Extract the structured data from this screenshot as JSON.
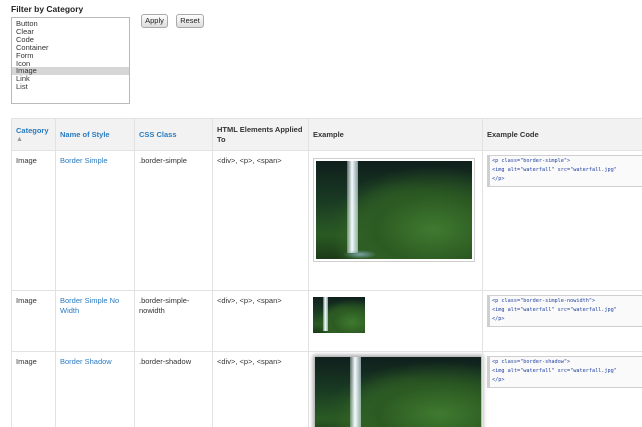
{
  "filter": {
    "title": "Filter by Category",
    "options": [
      "Button",
      "Clear",
      "Code",
      "Container",
      "Form",
      "Icon",
      "Image",
      "Link",
      "List"
    ],
    "selected": "Image",
    "apply_label": "Apply",
    "reset_label": "Reset"
  },
  "table": {
    "headers": {
      "category": "Category",
      "name": "Name of Style",
      "css_class": "CSS Class",
      "html_elements": "HTML Elements Applied To",
      "example": "Example",
      "example_code": "Example Code"
    },
    "sort_indicator": "▲",
    "rows": [
      {
        "category": "Image",
        "name": "Border Simple",
        "css_class": ".border-simple",
        "html_elements": "<div>, <p>, <span>",
        "code": [
          "<p class=\"border-simple\">",
          "<img alt=\"waterfall\" src=\"waterfall.jpg\"",
          "</p>"
        ]
      },
      {
        "category": "Image",
        "name": "Border Simple No Width",
        "css_class": ".border-simple-nowidth",
        "html_elements": "<div>, <p>, <span>",
        "code": [
          "<p class=\"border-simple-nowidth\">",
          "<img alt=\"waterfall\" src=\"waterfall.jpg\"",
          "</p>"
        ]
      },
      {
        "category": "Image",
        "name": "Border Shadow",
        "css_class": ".border-shadow",
        "html_elements": "<div>, <p>, <span>",
        "code": [
          "<p class=\"border-shadow\">",
          "<img alt=\"waterfall\" src=\"waterfall.jpg\"",
          "</p>"
        ]
      }
    ]
  },
  "colors": {
    "link": "#2a7bbf",
    "header_bg": "#f2f2f2",
    "border": "#e2e2e2"
  }
}
